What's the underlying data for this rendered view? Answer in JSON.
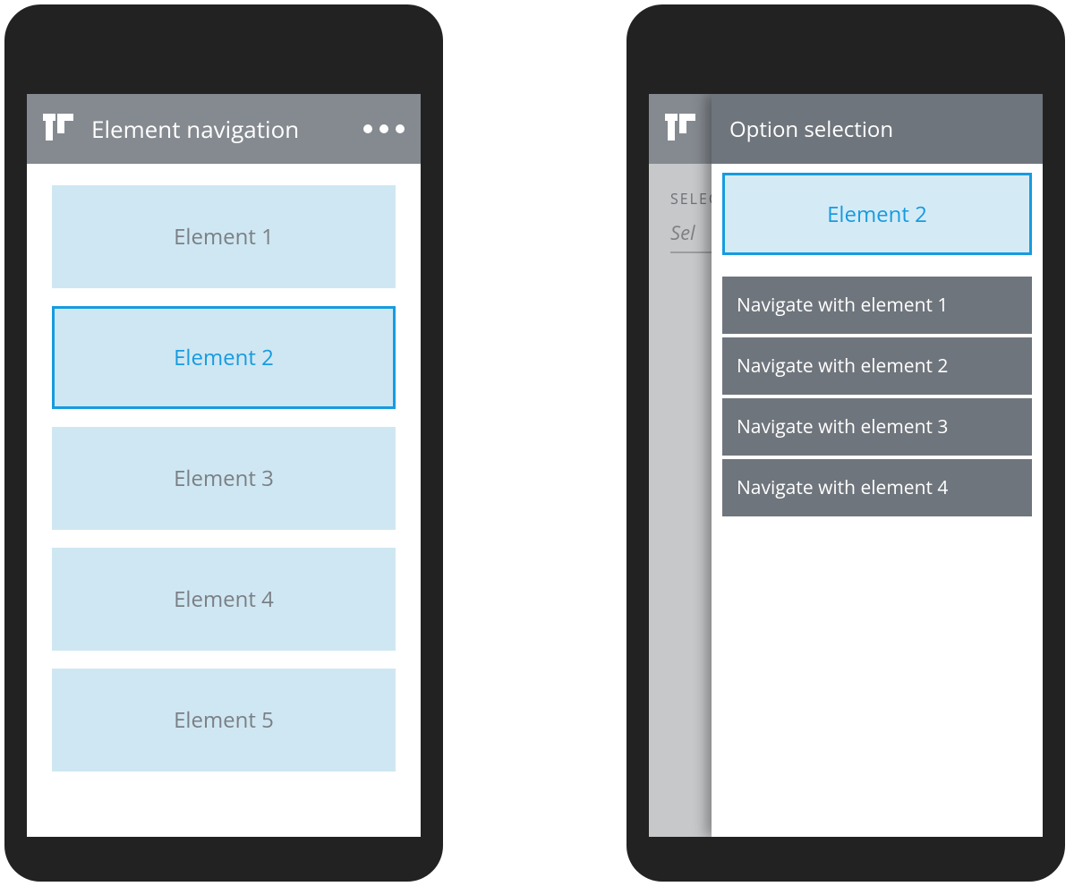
{
  "leftPhone": {
    "headerTitle": "Element navigation",
    "items": [
      {
        "label": "Element 1",
        "selected": false
      },
      {
        "label": "Element 2",
        "selected": true
      },
      {
        "label": "Element 3",
        "selected": false
      },
      {
        "label": "Element 4",
        "selected": false
      },
      {
        "label": "Element 5",
        "selected": false
      }
    ]
  },
  "rightPhone": {
    "bgFieldLabel": "SELECT AN OPTION",
    "bgFieldValuePartial": "Sel",
    "overlay": {
      "title": "Option selection",
      "selectedLabel": "Element 2",
      "options": [
        {
          "label": "Navigate with element 1"
        },
        {
          "label": "Navigate with element 2"
        },
        {
          "label": "Navigate with element 3"
        },
        {
          "label": "Navigate with element 4"
        }
      ]
    }
  }
}
